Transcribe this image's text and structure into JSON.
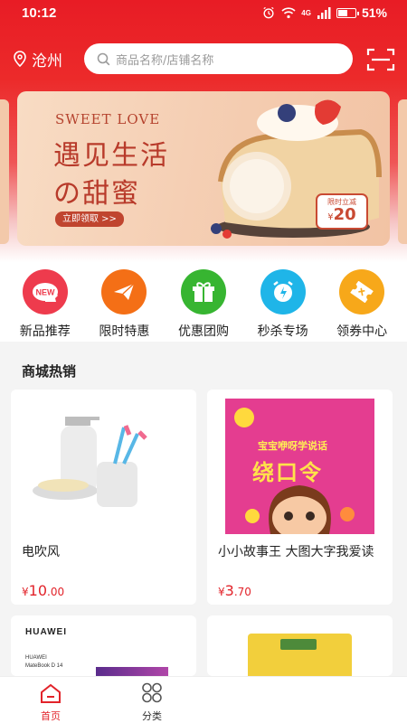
{
  "status_bar": {
    "time": "10:12",
    "network": "4G",
    "battery": "51%"
  },
  "header": {
    "city": "沧州",
    "search_placeholder": "商品名称/店铺名称"
  },
  "banner": {
    "tagline": "SWEET LOVE",
    "headline_1": "遇见生活",
    "headline_2": "の甜蜜",
    "button_label": "立即领取 >>",
    "tag_top": "限时立减",
    "tag_currency": "¥",
    "tag_value": "20"
  },
  "quick_menu": [
    {
      "label": "新品推荐",
      "icon": "new-badge-icon",
      "color": "#ee3b4d",
      "badge": "NEW"
    },
    {
      "label": "限时特惠",
      "icon": "paper-plane-icon",
      "color": "#f46f16"
    },
    {
      "label": "优惠团购",
      "icon": "gift-icon",
      "color": "#37b531"
    },
    {
      "label": "秒杀专场",
      "icon": "alarm-clock-icon",
      "color": "#1fb5e8"
    },
    {
      "label": "领券中心",
      "icon": "coupon-icon",
      "color": "#f7a81a"
    }
  ],
  "section": {
    "title": "商城热销"
  },
  "products": [
    {
      "name": "电吹风",
      "currency": "¥",
      "price_int": "10",
      "price_dec": ".00"
    },
    {
      "name": "小小故事王 大图大字我爱读",
      "currency": "¥",
      "price_int": "3",
      "price_dec": ".70",
      "cover_top": "宝宝咿呀学说话",
      "cover_title": "绕口令"
    },
    {
      "brand": "HUAWEI",
      "brand_small": "HUAWEI",
      "model": "MateBook D 14"
    },
    {
      "label": ""
    }
  ],
  "tab_bar": {
    "home": "首页",
    "category": "分类",
    "active_color": "#e2232a"
  }
}
